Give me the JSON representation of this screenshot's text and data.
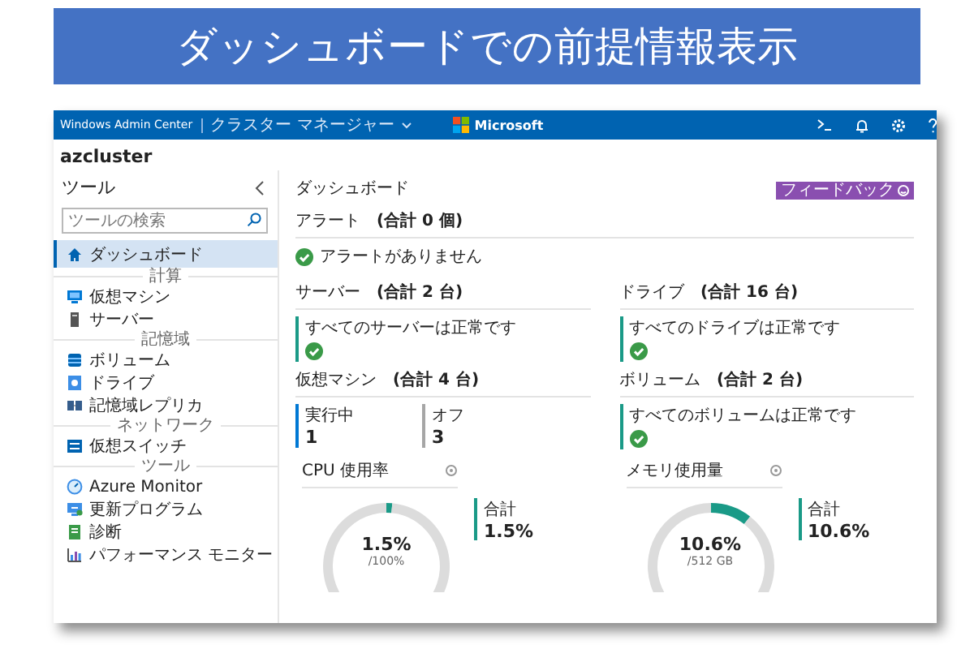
{
  "banner": {
    "title": "ダッシュボードでの前提情報表示"
  },
  "window": {
    "product": "Windows Admin Center",
    "context": "クラスター マネージャー",
    "brand": "Microsoft",
    "cluster": "azcluster"
  },
  "sidebar": {
    "title": "ツール",
    "search": {
      "placeholder": "ツールの検索"
    },
    "items": [
      {
        "kind": "item",
        "label": "ダッシュボード",
        "selected": true
      },
      {
        "kind": "header",
        "label": "計算"
      },
      {
        "kind": "item",
        "label": "仮想マシン",
        "selected": false
      },
      {
        "kind": "item",
        "label": "サーバー",
        "selected": false
      },
      {
        "kind": "header",
        "label": "記憶域"
      },
      {
        "kind": "item",
        "label": "ボリューム",
        "selected": false
      },
      {
        "kind": "item",
        "label": "ドライブ",
        "selected": false
      },
      {
        "kind": "item",
        "label": "記憶域レプリカ",
        "selected": false
      },
      {
        "kind": "header",
        "label": "ネットワーク"
      },
      {
        "kind": "item",
        "label": "仮想スイッチ",
        "selected": false
      },
      {
        "kind": "header",
        "label": "ツール"
      },
      {
        "kind": "item",
        "label": "Azure Monitor",
        "selected": false
      },
      {
        "kind": "item",
        "label": "更新プログラム",
        "selected": false
      },
      {
        "kind": "item",
        "label": "診断",
        "selected": false
      },
      {
        "kind": "item",
        "label": "パフォーマンス モニター",
        "selected": false
      }
    ]
  },
  "main": {
    "title": "ダッシュボード",
    "feedback_button": "フィードバック",
    "alerts": {
      "title": "アラート",
      "count": "(合計 0 個)",
      "message": "アラートがありません"
    },
    "tiles": [
      {
        "kind": "status",
        "title": "サーバー",
        "count": "(合計 2 台)",
        "message": "すべてのサーバーは正常です"
      },
      {
        "kind": "status",
        "title": "ドライブ",
        "count": "(合計 16 台)",
        "message": "すべてのドライブは正常です"
      },
      {
        "kind": "counts",
        "title": "仮想マシン",
        "count": "(合計 4 台)",
        "stats": [
          {
            "label": "実行中",
            "value": "1",
            "color": "#0078d4"
          },
          {
            "label": "オフ",
            "value": "3",
            "color": "#a6a6a6"
          }
        ]
      },
      {
        "kind": "status",
        "title": "ボリューム",
        "count": "(合計 2 台)",
        "message": "すべてのボリュームは正常です"
      },
      {
        "kind": "gauge",
        "title": "CPU 使用率",
        "chart_data": {
          "type": "donut",
          "values": [
            1.5,
            98.5
          ]
        },
        "reading": "1.5%",
        "scale": "/100%",
        "legend_label": "合計",
        "legend_value": "1.5%"
      },
      {
        "kind": "gauge",
        "title": "メモリ使用量",
        "chart_data": {
          "type": "donut",
          "values": [
            10.6,
            89.4
          ]
        },
        "reading": "10.6%",
        "scale": "/512 GB",
        "legend_label": "合計",
        "legend_value": "10.6%"
      }
    ]
  }
}
